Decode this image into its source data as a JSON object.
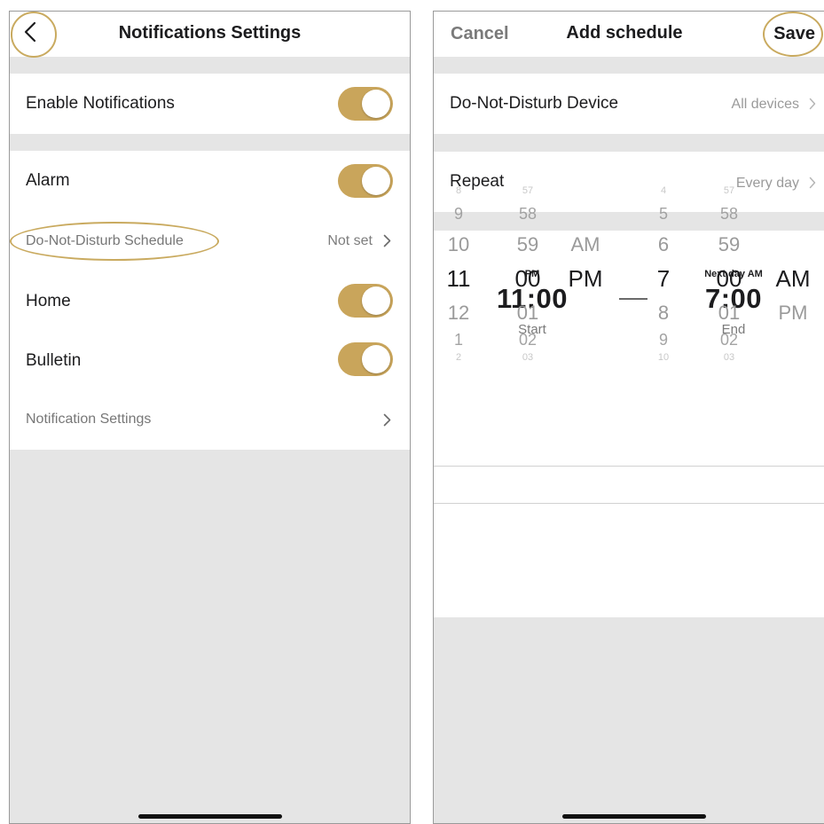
{
  "left_screen": {
    "title": "Notifications Settings",
    "rows": {
      "enable_notifications": "Enable Notifications",
      "alarm": "Alarm",
      "dnd_schedule": "Do-Not-Disturb Schedule",
      "dnd_schedule_value": "Not set",
      "home": "Home",
      "bulletin": "Bulletin",
      "notification_settings": "Notification Settings"
    },
    "toggles": {
      "enable_notifications": true,
      "alarm": true,
      "home": true,
      "bulletin": true
    }
  },
  "right_screen": {
    "cancel_label": "Cancel",
    "title": "Add schedule",
    "save_label": "Save",
    "dnd_device_label": "Do-Not-Disturb Device",
    "dnd_device_value": "All devices",
    "repeat_label": "Repeat",
    "repeat_value": "Every day",
    "start": {
      "period": "PM",
      "time": "11:00",
      "label": "Start"
    },
    "end": {
      "period": "Next day AM",
      "time": "7:00",
      "label": "End"
    },
    "picker": {
      "start_hour": [
        "8",
        "9",
        "10",
        "11",
        "12",
        "1",
        "2"
      ],
      "start_minute": [
        "57",
        "58",
        "59",
        "00",
        "01",
        "02",
        "03"
      ],
      "start_period": [
        "AM",
        "PM"
      ],
      "end_hour": [
        "4",
        "5",
        "6",
        "7",
        "8",
        "9",
        "10"
      ],
      "end_minute": [
        "57",
        "58",
        "59",
        "00",
        "01",
        "02",
        "03"
      ],
      "end_period": [
        "AM",
        "PM"
      ]
    }
  },
  "colors": {
    "accent": "#c9a55b",
    "highlight_outline": "#c9aa5f",
    "background": "#e5e5e5"
  },
  "icons": {
    "back": "chevron-left-icon",
    "disclosure": "chevron-right-icon"
  }
}
